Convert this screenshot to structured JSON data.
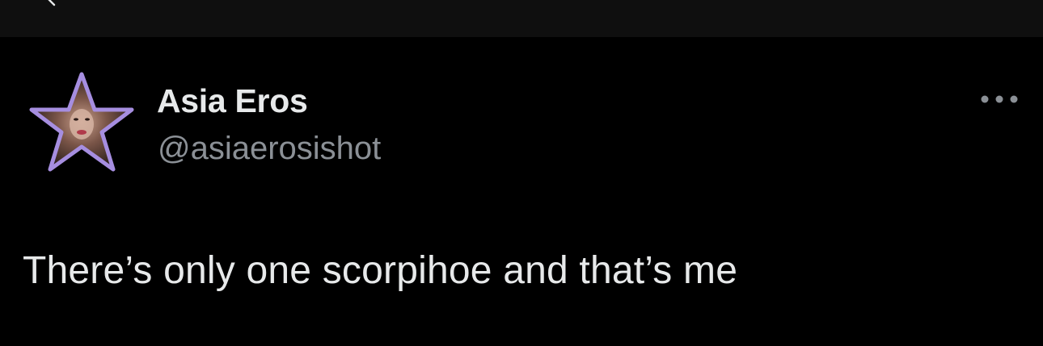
{
  "tweet": {
    "display_name": "Asia Eros",
    "handle": "@asiaerosishot",
    "text": "There’s only one scorpihoe and that’s me",
    "avatar_icon": "star-avatar-icon",
    "more_icon": "more-options-icon"
  },
  "colors": {
    "background": "#000000",
    "top_bar": "#0f0f0f",
    "primary_text": "#e7e9ea",
    "secondary_text": "#8b9096",
    "avatar_border": "#a68ee0"
  }
}
